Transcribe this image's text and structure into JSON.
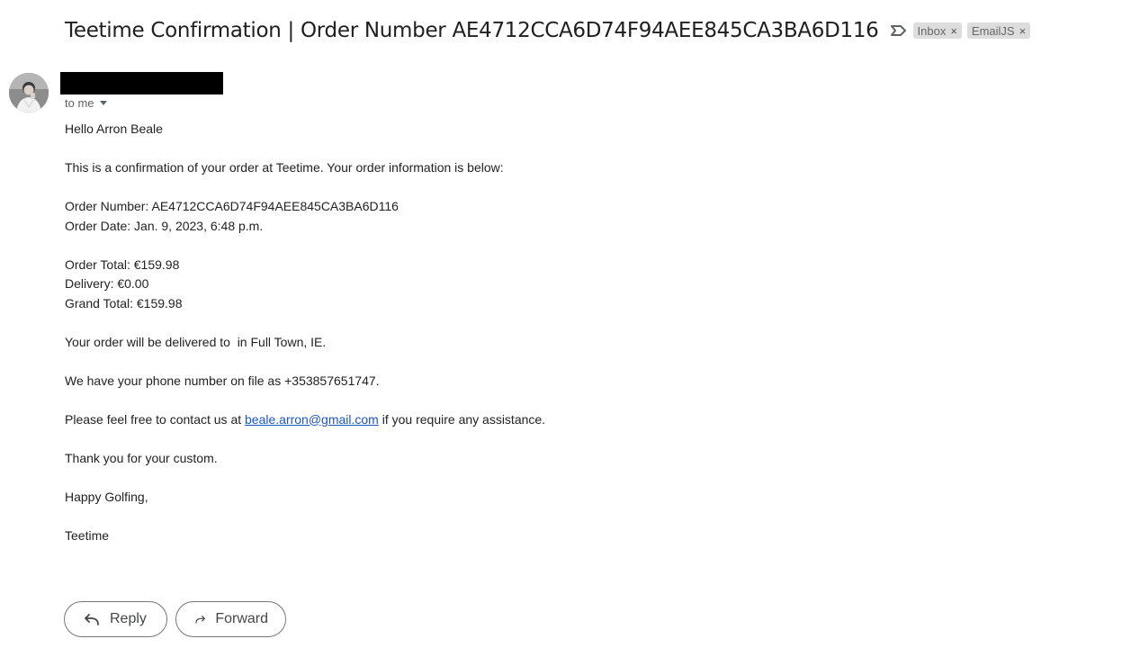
{
  "email": {
    "subject": "Teetime Confirmation | Order Number AE4712CCA6D74F94AEE845CA3BA6D116",
    "labels": [
      {
        "name": "Inbox",
        "close": "×"
      },
      {
        "name": "EmailJS",
        "close": "×"
      }
    ],
    "recipient": "to me",
    "body": {
      "greeting": "Hello Arron Beale",
      "intro": "This is a confirmation of your order at Teetime. Your order information is below:",
      "order_number": "Order Number: AE4712CCA6D74F94AEE845CA3BA6D116",
      "order_date": "Order Date: Jan. 9, 2023, 6:48 p.m.",
      "order_total": "Order Total: €159.98",
      "delivery": "Delivery: €0.00",
      "grand_total": "Grand Total: €159.98",
      "delivery_address": "Your order will be delivered to  in Full Town, IE.",
      "phone": "We have your phone number on file as +353857651747.",
      "contact_prefix": "Please feel free to contact us at ",
      "contact_email": "beale.arron@gmail.com",
      "contact_suffix": " if you require any assistance.",
      "thanks": "Thank you for your custom.",
      "closing": "Happy Golfing,",
      "signature": "Teetime"
    }
  },
  "actions": {
    "reply_label": "Reply",
    "forward_label": "Forward"
  },
  "icons": {
    "important": "important-marker-icon",
    "reply": "reply-arrow-icon",
    "forward": "forward-arrow-icon",
    "avatar": "sender-avatar"
  },
  "colors": {
    "link": "#1a55c4",
    "chip_bg": "#dddddd",
    "button_border": "#747775"
  }
}
